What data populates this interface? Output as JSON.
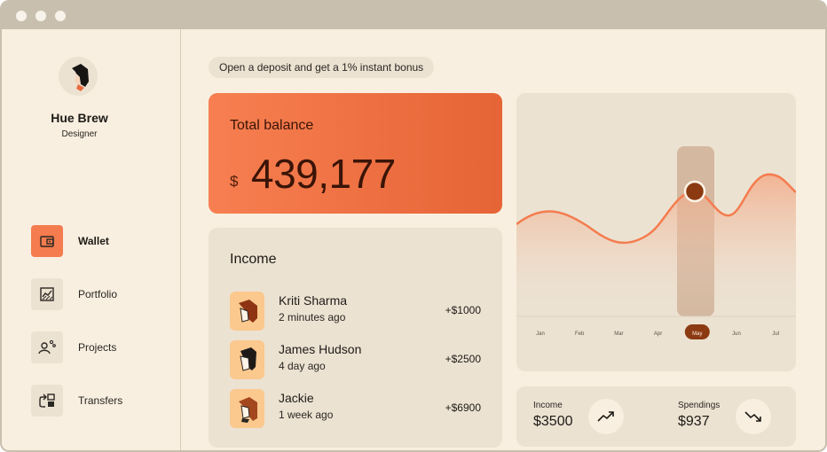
{
  "banner": {
    "text": "Open a deposit and get a 1% instant bonus"
  },
  "profile": {
    "name": "Hue Brew",
    "role": "Designer"
  },
  "nav": [
    {
      "label": "Wallet",
      "icon": "wallet-icon",
      "active": true
    },
    {
      "label": "Portfolio",
      "icon": "portfolio-chart-icon",
      "active": false
    },
    {
      "label": "Projects",
      "icon": "projects-people-icon",
      "active": false
    },
    {
      "label": "Transfers",
      "icon": "transfers-icon",
      "active": false
    }
  ],
  "balance": {
    "title": "Total balance",
    "currency": "$",
    "value": "439,177"
  },
  "income": {
    "title": "Income",
    "rows": [
      {
        "name": "Kriti Sharma",
        "time": "2 minutes ago",
        "amount": "+$1000"
      },
      {
        "name": "James Hudson",
        "time": "4 day ago",
        "amount": "+$2500"
      },
      {
        "name": "Jackie",
        "time": "1 week ago",
        "amount": "+$6900"
      }
    ]
  },
  "chart_data": {
    "type": "area",
    "categories": [
      "Jan",
      "Feb",
      "Mar",
      "Apr",
      "May",
      "Jun",
      "Jul"
    ],
    "selected": "May",
    "title": "",
    "xlabel": "",
    "ylabel": "",
    "grid": false
  },
  "stats": {
    "income": {
      "label": "Income",
      "value": "$3500",
      "icon": "trend-up-icon"
    },
    "spendings": {
      "label": "Spendings",
      "value": "$937",
      "icon": "trend-down-icon"
    }
  },
  "colors": {
    "accent": "#f47c4f",
    "background": "#f8efe0",
    "card": "#ece2d2",
    "selected": "#8c3a11"
  }
}
